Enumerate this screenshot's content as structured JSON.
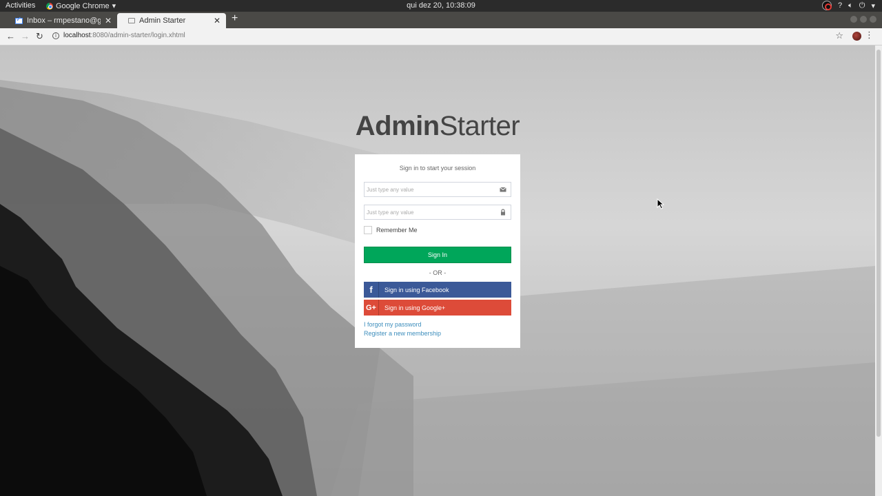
{
  "system_bar": {
    "activities": "Activities",
    "app_name": "Google Chrome",
    "clock": "qui dez 20, 10:38:09"
  },
  "browser": {
    "tabs": [
      {
        "title": "Inbox – rmpestano@gmail.com",
        "active": false
      },
      {
        "title": "Admin Starter",
        "active": true
      }
    ],
    "new_tab_icon": "plus-icon",
    "url_host": "localhost",
    "url_path": ":8080/admin-starter/login.xhtml"
  },
  "page": {
    "logo_bold": "Admin",
    "logo_light": "Starter",
    "login_message": "Sign in to start your session",
    "email_placeholder": "Just type any value",
    "password_placeholder": "Just type any value",
    "remember_label": "Remember Me",
    "signin_label": "Sign In",
    "or_label": "- OR -",
    "facebook_label": "Sign in using Facebook",
    "google_label": "Sign in using Google+",
    "forgot_label": "I forgot my password",
    "register_label": "Register a new membership"
  },
  "colors": {
    "signin": "#00a65a",
    "facebook": "#3b5998",
    "google": "#dd4b39",
    "link": "#3c8dbc"
  }
}
